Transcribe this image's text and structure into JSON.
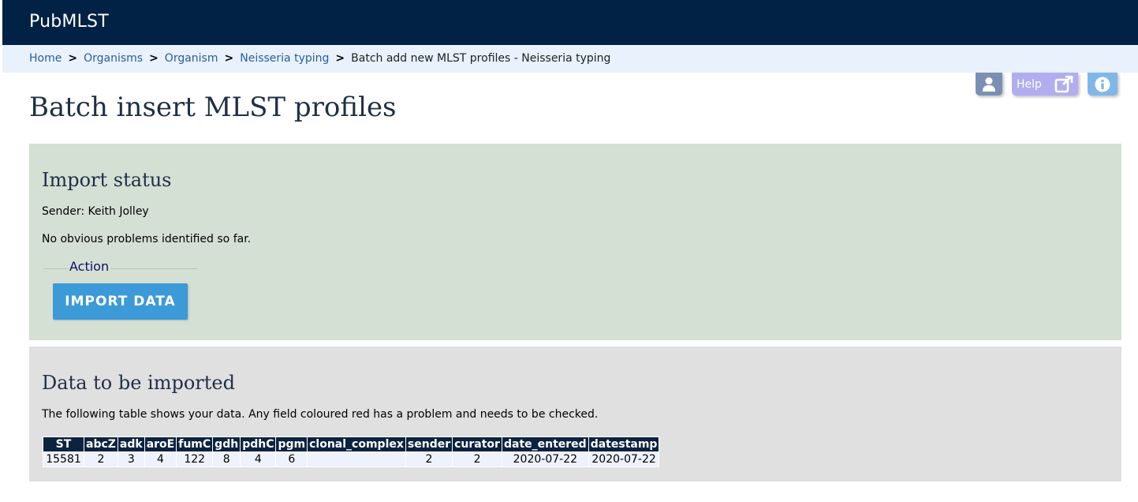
{
  "header": {
    "brand": "PubMLST"
  },
  "breadcrumb": {
    "links": [
      "Home",
      "Organisms",
      "Organism",
      "Neisseria typing"
    ],
    "separator": ">",
    "current": "Batch add new MLST profiles - Neisseria typing"
  },
  "toolbar": {
    "help_label": "Help"
  },
  "page": {
    "title": "Batch insert MLST profiles"
  },
  "status": {
    "heading": "Import status",
    "sender": "Sender: Keith Jolley",
    "message": "No obvious problems identified so far.",
    "action_legend": "Action",
    "import_button": "IMPORT DATA"
  },
  "data_section": {
    "heading": "Data to be imported",
    "description": "The following table shows your data. Any field coloured red has a problem and needs to be checked.",
    "columns": [
      "ST",
      "abcZ",
      "adk",
      "aroE",
      "fumC",
      "gdh",
      "pdhC",
      "pgm",
      "clonal_complex",
      "sender",
      "curator",
      "date_entered",
      "datestamp"
    ],
    "rows": [
      [
        "15581",
        "2",
        "3",
        "4",
        "122",
        "8",
        "4",
        "6",
        "",
        "2",
        "2",
        "2020-07-22",
        "2020-07-22"
      ]
    ]
  },
  "colors": {
    "header_bg": "#012245",
    "breadcrumb_bg": "#e8f1fc",
    "status_panel_bg": "#d5e0d5",
    "data_panel_bg": "#e0e0e0",
    "button_bg": "#3c9ad8",
    "table_header_bg": "#0c2340"
  },
  "icons": {
    "user": "user-icon",
    "help_external": "external-link-icon",
    "info": "info-icon"
  }
}
